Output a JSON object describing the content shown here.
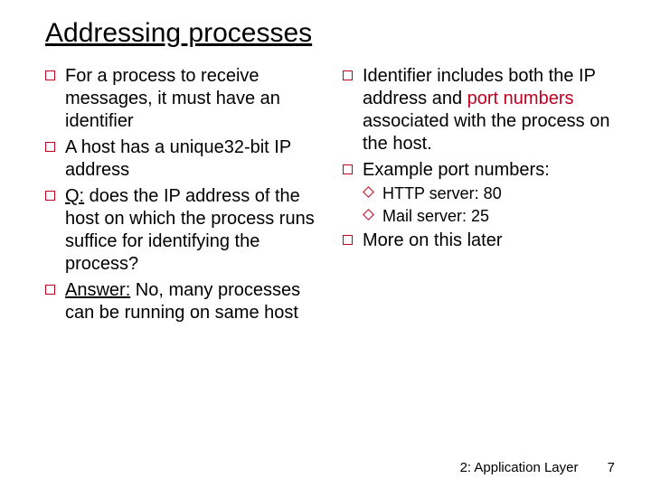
{
  "title": "Addressing processes",
  "left": {
    "items": [
      "For a process to receive messages, it must have an identifier",
      "A host has a unique32-bit IP address",
      {
        "prefix": "Q:",
        "rest": " does the IP address of the host on which the process runs suffice for identifying the process?"
      },
      {
        "prefix": "Answer:",
        "rest": " No, many processes can be running on same host"
      }
    ]
  },
  "right": {
    "identifier_includes_pre": "Identifier includes both the IP address and ",
    "port_numbers": "port numbers",
    "identifier_includes_post": " associated with the process on the host.",
    "example_label": "Example port numbers:",
    "examples": [
      "HTTP server: 80",
      "Mail server: 25"
    ],
    "more": "More on this later"
  },
  "footer": {
    "section": "2: Application Layer",
    "page": "7"
  }
}
